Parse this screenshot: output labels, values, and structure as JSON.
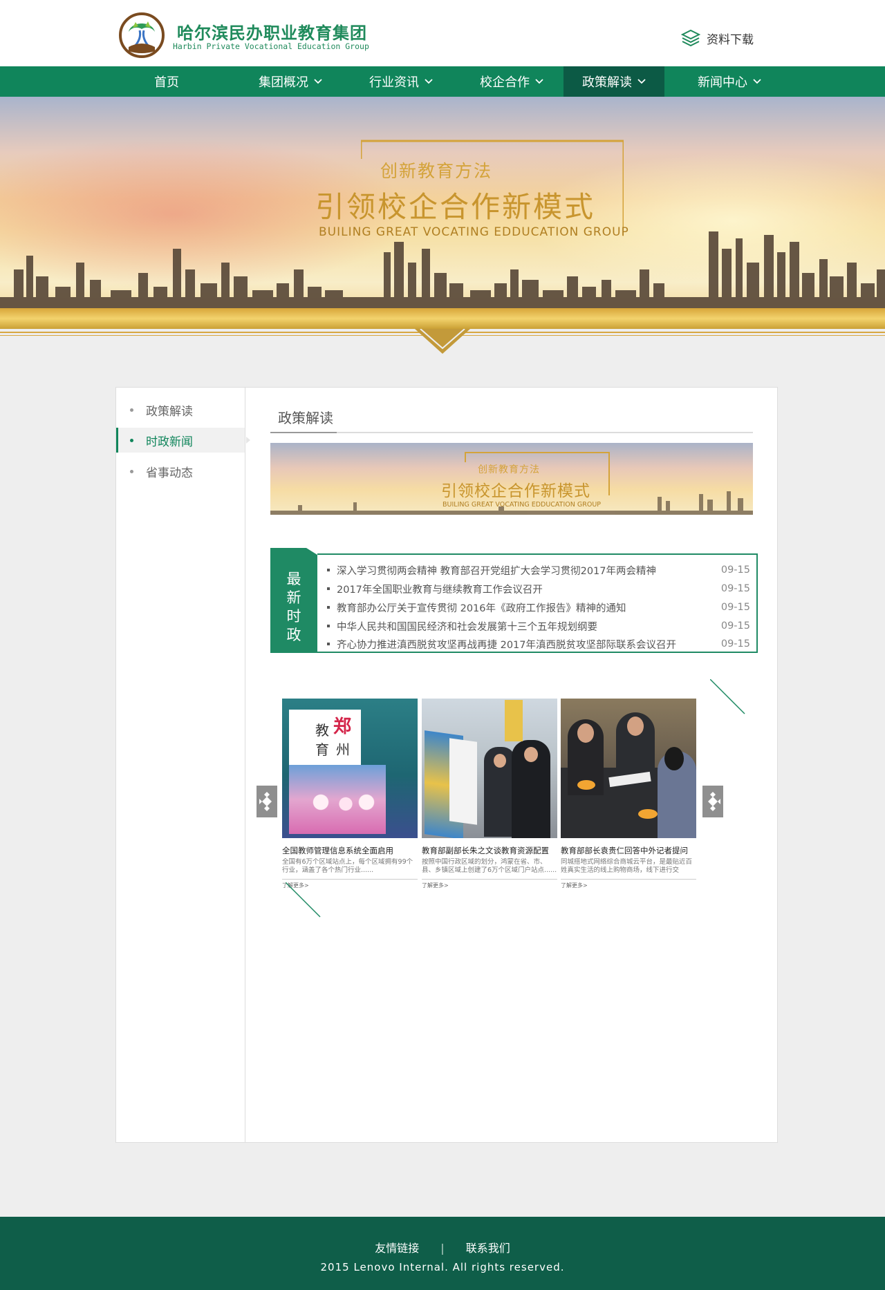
{
  "header": {
    "brand_cn": "哈尔滨民办职业教育集团",
    "brand_en": "Harbin Private Vocational Education Group",
    "download_label": "资料下载",
    "brand_color": "#1f8a5b"
  },
  "nav": {
    "items": [
      {
        "label": "首页",
        "has_dropdown": false,
        "active": false
      },
      {
        "label": "集团概况",
        "has_dropdown": true,
        "active": false
      },
      {
        "label": "行业资讯",
        "has_dropdown": true,
        "active": false
      },
      {
        "label": "校企合作",
        "has_dropdown": true,
        "active": false
      },
      {
        "label": "政策解读",
        "has_dropdown": true,
        "active": true
      },
      {
        "label": "新闻中心",
        "has_dropdown": true,
        "active": false
      }
    ],
    "bg_color": "#10855b",
    "active_color": "#0c5a45"
  },
  "hero": {
    "line1": "创新教育方法",
    "line2": "引领校企合作新模式",
    "line3": "BUILING GREAT VOCATING EDDUCATION GROUP"
  },
  "sidebar": {
    "items": [
      {
        "label": "政策解读",
        "active": false
      },
      {
        "label": "时政新闻",
        "active": true
      },
      {
        "label": "省事动态",
        "active": false
      }
    ]
  },
  "main": {
    "title": "政策解读",
    "banner": {
      "line1": "创新教育方法",
      "line2": "引领校企合作新模式",
      "line3": "BUILING GREAT VOCATING EDDUCATION GROUP"
    }
  },
  "news": {
    "label": "最新时政",
    "items": [
      {
        "title": "深入学习贯彻两会精神 教育部召开党组扩大会学习贯彻2017年两会精神",
        "date": "09-15"
      },
      {
        "title": "2017年全国职业教育与继续教育工作会议召开",
        "date": "09-15"
      },
      {
        "title": "教育部办公厅关于宣传贯彻 2016年《政府工作报告》精神的通知",
        "date": "09-15"
      },
      {
        "title": "中华人民共和国国民经济和社会发展第十三个五年规划纲要",
        "date": "09-15"
      },
      {
        "title": "齐心协力推进滇西脱贫攻坚再战再捷 2017年滇西脱贫攻坚部际联系会议召开",
        "date": "09-15"
      }
    ]
  },
  "carousel": {
    "cards": [
      {
        "title": "全国教师管理信息系统全面启用",
        "desc": "全国有6万个区域站点上，每个区域拥有99个行业，涵盖了各个热门行业......",
        "more": "了解更多>",
        "image_text_1": "教",
        "image_text_2": "郑",
        "image_text_3": "育",
        "image_text_4": "州"
      },
      {
        "title": "教育部副部长朱之文谈教育资源配置",
        "desc": "按照中国行政区域的划分，鸿蒙在省、市、县、乡镇区域上创建了6万个区域门户站点......",
        "more": "了解更多>"
      },
      {
        "title": "教育部部长袁贵仁回答中外记者提问",
        "desc": "同城搭地式网络综合商城云平台，是最贴近百姓真实生活的线上购物商场，线下进行交易......",
        "more": "了解更多>"
      }
    ]
  },
  "footer": {
    "link1": "友情链接",
    "separator": "|",
    "link2": "联系我们",
    "copyright": "2015 Lenovo Internal. All rights reserved.",
    "bg_color": "#0f5e49"
  }
}
